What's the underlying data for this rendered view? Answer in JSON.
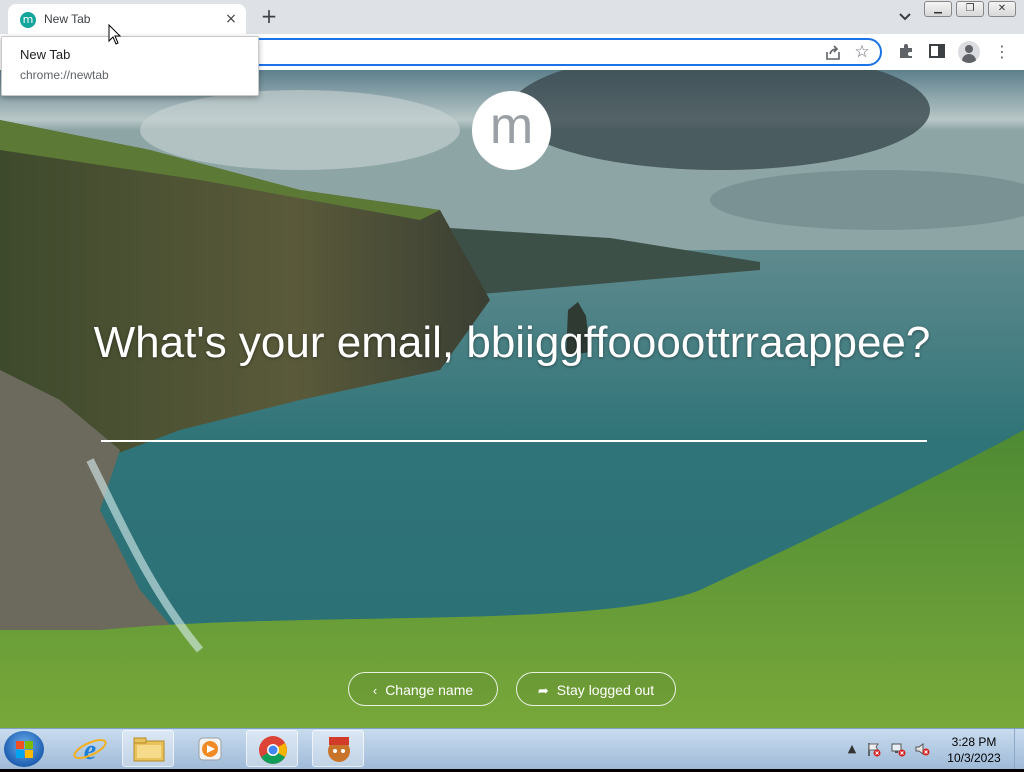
{
  "browser": {
    "tab": {
      "title": "New Tab",
      "favicon_letter": "m"
    },
    "hovercard": {
      "title": "New Tab",
      "url": "chrome://newtab"
    },
    "new_tab_symbol": "+",
    "close_symbol": "×"
  },
  "page": {
    "logo_letter": "m",
    "question": "What's your email, bbiiggffoooottrraappee?",
    "email_value": "",
    "buttons": {
      "change_name": "Change name",
      "stay_logged_out": "Stay logged out"
    }
  },
  "taskbar": {
    "clock_time": "3:28 PM",
    "clock_date": "10/3/2023",
    "apps": [
      "internet-explorer",
      "file-explorer",
      "media-player",
      "chrome",
      "game-app"
    ]
  },
  "colors": {
    "accent": "#1a73e8",
    "favicon": "#16a59a"
  }
}
